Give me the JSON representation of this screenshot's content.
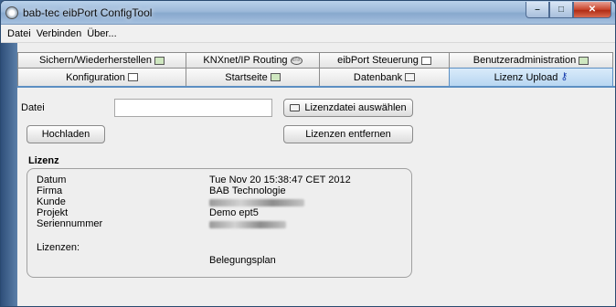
{
  "window": {
    "title": "bab-tec eibPort ConfigTool"
  },
  "menu": [
    "Datei",
    "Verbinden",
    "Über..."
  ],
  "tabs_row1": [
    {
      "label": "Sichern/Wiederherstellen",
      "icon": "document-icon"
    },
    {
      "label": "KNXnet/IP Routing",
      "icon": "knx-icon"
    },
    {
      "label": "eibPort Steuerung",
      "icon": "monitor-icon"
    },
    {
      "label": "Benutzeradministration",
      "icon": "user-admin-icon"
    }
  ],
  "tabs_row2": [
    {
      "label": "Konfiguration",
      "icon": "config-icon"
    },
    {
      "label": "Startseite",
      "icon": "home-icon"
    },
    {
      "label": "Datenbank",
      "icon": "database-icon"
    },
    {
      "label": "Lizenz Upload",
      "icon": "key-icon",
      "active": true
    }
  ],
  "form": {
    "file_label": "Datei",
    "file_value": "",
    "select_button": "Lizenzdatei auswählen",
    "upload_button": "Hochladen",
    "remove_button": "Lizenzen entfernen"
  },
  "license": {
    "section_title": "Lizenz",
    "labels": {
      "date": "Datum",
      "company": "Firma",
      "customer": "Kunde",
      "project": "Projekt",
      "serial": "Seriennummer",
      "licenses": "Lizenzen:"
    },
    "values": {
      "date": "Tue Nov 20 15:38:47 CET 2012",
      "company": "BAB Technologie",
      "project": "Demo ept5",
      "licenses": "Belegungsplan"
    }
  },
  "colors": {
    "active_tab": "#b8d6f1",
    "titlebar": "#9db9d9",
    "close_button": "#c8442c"
  }
}
